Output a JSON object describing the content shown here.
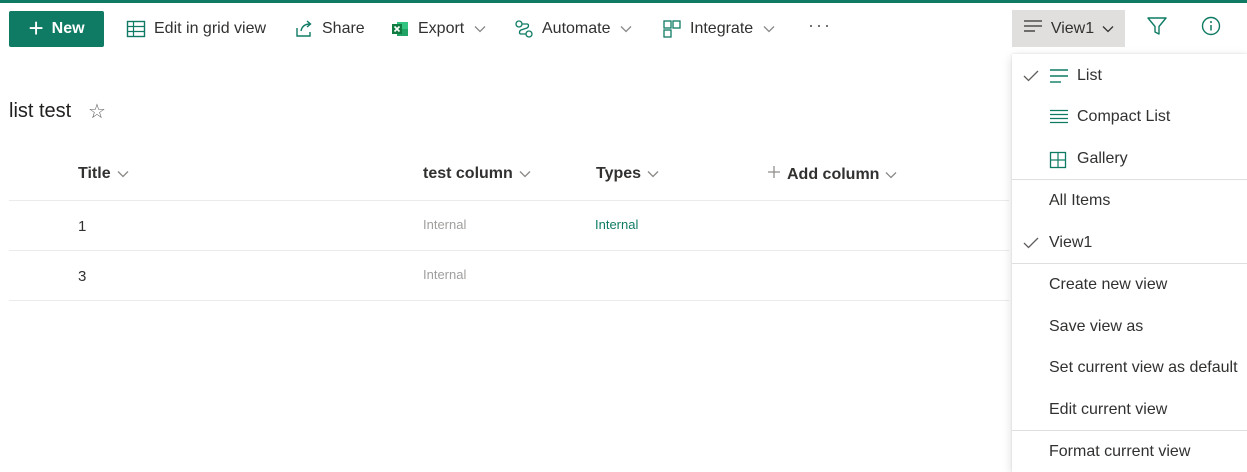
{
  "toolbar": {
    "new_label": "New",
    "edit_grid_label": "Edit in grid view",
    "share_label": "Share",
    "export_label": "Export",
    "automate_label": "Automate",
    "integrate_label": "Integrate",
    "more_label": "···",
    "view_label": "View1"
  },
  "list": {
    "title": "list test",
    "star": "☆"
  },
  "table": {
    "columns": {
      "title": "Title",
      "test_column": "test column",
      "types": "Types",
      "add_column": "Add column"
    },
    "rows": [
      {
        "title": "1",
        "test_column": "Internal",
        "types": "Internal"
      },
      {
        "title": "3",
        "test_column": "Internal",
        "types": ""
      }
    ]
  },
  "view_menu": {
    "layouts": [
      "List",
      "Compact List",
      "Gallery"
    ],
    "views": [
      "All Items",
      "View1"
    ],
    "actions": [
      "Create new view",
      "Save view as",
      "Set current view as default",
      "Edit current view"
    ],
    "format": "Format current view"
  },
  "colors": {
    "accent": "#0f7b64",
    "selected_bg": "#e1dfdd",
    "muted_text": "#a19f9d"
  },
  "icons": {
    "new": "plus-icon",
    "edit_grid": "grid-icon",
    "share": "share-icon",
    "export": "excel-icon",
    "automate": "flow-icon",
    "integrate": "integrate-icon",
    "view": "list-lines-icon",
    "filter": "filter-icon",
    "info": "info-icon"
  }
}
